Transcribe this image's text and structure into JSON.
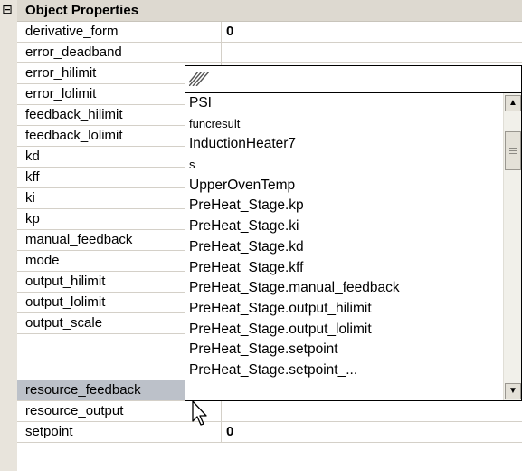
{
  "category": {
    "title": "Object Properties",
    "collapse_glyph": "⊟"
  },
  "properties": [
    {
      "name": "derivative_form",
      "value": "0"
    },
    {
      "name": "error_deadband",
      "value": ""
    },
    {
      "name": "error_hilimit",
      "value": ""
    },
    {
      "name": "error_lolimit",
      "value": ""
    },
    {
      "name": "feedback_hilimit",
      "value": ""
    },
    {
      "name": "feedback_lolimit",
      "value": ""
    },
    {
      "name": "kd",
      "value": ""
    },
    {
      "name": "kff",
      "value": ""
    },
    {
      "name": "ki",
      "value": ""
    },
    {
      "name": "kp",
      "value": ""
    },
    {
      "name": "manual_feedback",
      "value": ""
    },
    {
      "name": "mode",
      "value": ""
    },
    {
      "name": "output_hilimit",
      "value": ""
    },
    {
      "name": "output_lolimit",
      "value": ""
    },
    {
      "name": "output_scale",
      "value": ""
    },
    {
      "name": "resource_feedback",
      "value": ""
    },
    {
      "name": "resource_output",
      "value": ""
    },
    {
      "name": "setpoint",
      "value": "0"
    }
  ],
  "dropdown": {
    "search_icon": "hatch-icon",
    "items": [
      "PSI",
      "funcresult",
      "InductionHeater7",
      "s",
      "UpperOvenTemp",
      "PreHeat_Stage.kp",
      "PreHeat_Stage.ki",
      "PreHeat_Stage.kd",
      "PreHeat_Stage.kff",
      "PreHeat_Stage.manual_feedback",
      "PreHeat_Stage.output_hilimit",
      "PreHeat_Stage.output_lolimit",
      "PreHeat_Stage.setpoint",
      "PreHeat_Stage.setpoint_..."
    ],
    "scroll_up_icon": "triangle-up-icon",
    "scroll_down_icon": "triangle-down-icon"
  },
  "selected_row": "resource_feedback",
  "colors": {
    "header_bg": "#ddd9d0",
    "selection_bg": "#bcc1c9",
    "gridline": "#d4d0c8"
  }
}
